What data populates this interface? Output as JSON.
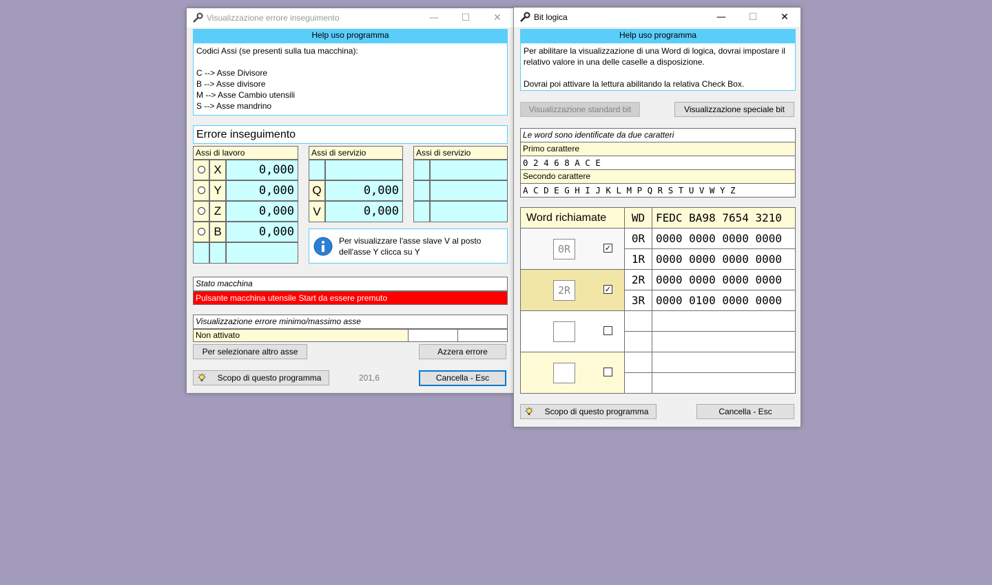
{
  "win1": {
    "title": "Visualizzazione errore inseguimento",
    "help_header": "Help uso programma",
    "help_text": "Codici Assi (se presenti sulla tua macchina):\n\nC --> Asse Divisore\nB --> Asse divisore\nM --> Asse Cambio utensili\nS --> Asse mandrino",
    "error_title": "Errore inseguimento",
    "work_axes": {
      "header": "Assi di lavoro",
      "rows": [
        {
          "axis": "X",
          "value": "0,000"
        },
        {
          "axis": "Y",
          "value": "0,000"
        },
        {
          "axis": "Z",
          "value": "0,000"
        },
        {
          "axis": "B",
          "value": "0,000"
        }
      ]
    },
    "service_axes_1": {
      "header": "Assi di servizio",
      "rows": [
        {
          "axis": "Q",
          "value": "0,000"
        },
        {
          "axis": "V",
          "value": "0,000"
        }
      ]
    },
    "service_axes_2": {
      "header": "Assi di servizio"
    },
    "info_text": "Per visualizzare l'asse slave V al posto dell'asse Y clicca su Y",
    "machine_state": {
      "label": "Stato macchina",
      "value": "Pulsante macchina utensile Start da essere premuto"
    },
    "minmax": {
      "label": "Visualizzazione errore minimo/massimo asse",
      "value": "Non attivato"
    },
    "select_axis_button": "Per selezionare altro asse",
    "reset_error_button": "Azzera errore",
    "scope_button": "Scopo di questo programma",
    "version": "201,6",
    "cancel_button": "Cancella - Esc"
  },
  "win2": {
    "title": "Bit logica",
    "help_header": "Help uso programma",
    "help_text": "Per abilitare la visualizzazione di una Word di logica, dovrai impostare il relativo valore in una delle caselle a disposizione.\n\nDovrai poi attivare la lettura abilitando la relativa Check Box.",
    "standard_bit_button": "Visualizzazione standard bit",
    "special_bit_button": "Visualizzazione speciale bit",
    "id_info": {
      "title": "Le word sono identificate da due caratteri",
      "first_label": "Primo carattere",
      "first_chars": "0 2 4 6 8 A C E",
      "second_label": "Secondo carattere",
      "second_chars": "A C D E G H I J K L M P Q R S T U V W Y Z"
    },
    "words": {
      "header": "Word richiamate",
      "wd_header": "WD",
      "bits_header": "FEDC BA98 7654 3210",
      "groups": [
        {
          "input": "0R",
          "checked": true,
          "rows": [
            {
              "wd": "0R",
              "bits": "0000 0000 0000 0000"
            },
            {
              "wd": "1R",
              "bits": "0000 0000 0000 0000"
            }
          ]
        },
        {
          "input": "2R",
          "checked": true,
          "rows": [
            {
              "wd": "2R",
              "bits": "0000 0000 0000 0000"
            },
            {
              "wd": "3R",
              "bits": "0000 0100 0000 0000"
            }
          ]
        },
        {
          "input": "",
          "checked": false,
          "rows": [
            {
              "wd": "",
              "bits": ""
            },
            {
              "wd": "",
              "bits": ""
            }
          ]
        },
        {
          "input": "",
          "checked": false,
          "rows": [
            {
              "wd": "",
              "bits": ""
            },
            {
              "wd": "",
              "bits": ""
            }
          ]
        }
      ]
    },
    "scope_button": "Scopo di questo programma",
    "cancel_button": "Cancella - Esc"
  },
  "colors": {
    "desktop": "#a39bbb",
    "help_header": "#5bcdfb",
    "cell_yellow": "#fffbd6",
    "cell_cyan": "#ccffff",
    "alarm_red": "#ff0000",
    "accent_blue": "#0078d7"
  }
}
